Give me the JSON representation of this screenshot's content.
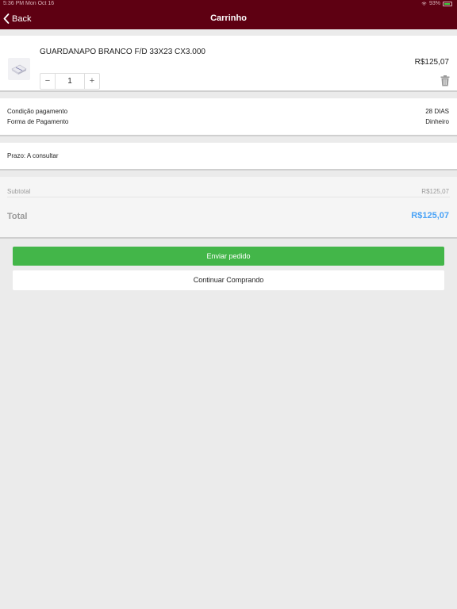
{
  "status_bar": {
    "time": "5:36 PM   Mon Oct 16",
    "battery": "93%"
  },
  "nav": {
    "back_label": "Back",
    "title": "Carrinho"
  },
  "cart_item": {
    "name": "GUARDANAPO BRANCO F/D 33X23 CX3.000",
    "price": "R$125,07",
    "quantity": "1",
    "minus": "−",
    "plus": "+"
  },
  "payment": {
    "condition_label": "Condição pagamento",
    "condition_value": "28 DIAS",
    "method_label": "Forma de Pagamento",
    "method_value": "Dinheiro"
  },
  "delivery": {
    "term": "Prazo: A consultar"
  },
  "summary": {
    "subtotal_label": "Subtotal",
    "subtotal_value": "R$125,07",
    "total_label": "Total",
    "total_value": "R$125,07"
  },
  "actions": {
    "send_label": "Enviar pedido",
    "continue_label": "Continuar Comprando"
  },
  "colors": {
    "nav_bg": "#5e0012",
    "send_bg": "#43b649",
    "total_accent": "#4aa3f7"
  }
}
